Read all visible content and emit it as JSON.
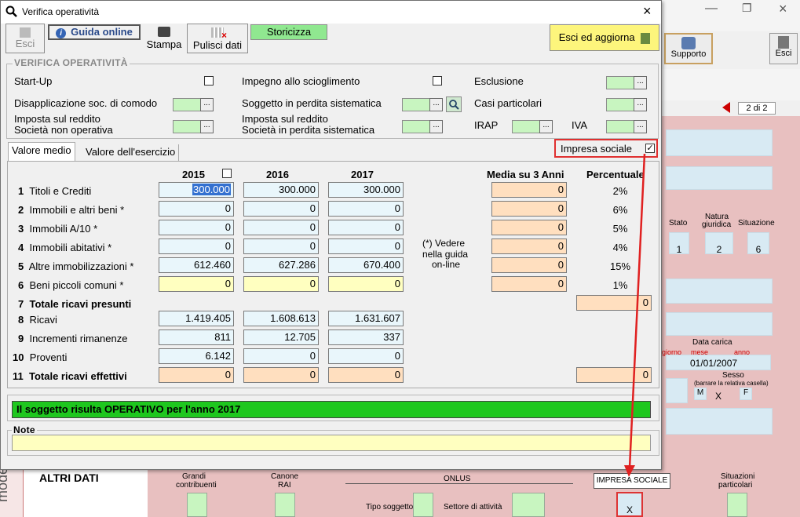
{
  "window": {
    "title": "Verifica operatività",
    "close": "×"
  },
  "toolbar": {
    "esci": "Esci",
    "guida": "Guida online",
    "stampa": "Stampa",
    "pulisci": "Pulisci dati",
    "storicizza": "Storicizza",
    "esci_aggiorna": "Esci ed aggiorna"
  },
  "section_title": "VERIFICA OPERATIVITÀ",
  "fields": {
    "startup": "Start-Up",
    "impegno": "Impegno allo scioglimento",
    "esclusione": "Esclusione",
    "disapplicazione": "Disapplicazione soc. di comodo",
    "soggetto_perdita": "Soggetto in perdita sistematica",
    "casi_particolari": "Casi particolari",
    "imposta1_l1": "Imposta sul reddito",
    "imposta1_l2": "Società non operativa",
    "imposta2_l1": "Imposta sul reddito",
    "imposta2_l2": "Società in perdita sistematica",
    "irap": "IRAP",
    "iva": "IVA",
    "dots": "..."
  },
  "tabs": [
    "Valore medio",
    "Valore dell'esercizio"
  ],
  "impresa_sociale": "Impresa sociale",
  "years": [
    "2015",
    "2016",
    "2017"
  ],
  "media_label": "Media su 3 Anni",
  "percentuale_label": "Percentuale",
  "note_vedere": [
    "(*) Vedere",
    "nella guida",
    "on-line"
  ],
  "rows": [
    {
      "n": "1",
      "label": "Titoli e Crediti",
      "v": [
        "300.000",
        "300.000",
        "300.000"
      ],
      "media": "0",
      "pct": "2%"
    },
    {
      "n": "2",
      "label": "Immobili e altri beni *",
      "v": [
        "0",
        "0",
        "0"
      ],
      "media": "0",
      "pct": "6%"
    },
    {
      "n": "3",
      "label": "Immobili A/10 *",
      "v": [
        "0",
        "0",
        "0"
      ],
      "media": "0",
      "pct": "5%"
    },
    {
      "n": "4",
      "label": "Immobili abitativi *",
      "v": [
        "0",
        "0",
        "0"
      ],
      "media": "0",
      "pct": "4%"
    },
    {
      "n": "5",
      "label": "Altre immobilizzazioni *",
      "v": [
        "612.460",
        "627.286",
        "670.400"
      ],
      "media": "0",
      "pct": "15%"
    },
    {
      "n": "6",
      "label": "Beni piccoli comuni *",
      "v": [
        "0",
        "0",
        "0"
      ],
      "media": "0",
      "pct": "1%"
    },
    {
      "n": "7",
      "label": "Totale ricavi presunti",
      "total": "0"
    },
    {
      "n": "8",
      "label": "Ricavi",
      "v": [
        "1.419.405",
        "1.608.613",
        "1.631.607"
      ]
    },
    {
      "n": "9",
      "label": "Incrementi rimanenze",
      "v": [
        "811",
        "12.705",
        "337"
      ]
    },
    {
      "n": "10",
      "label": "Proventi",
      "v": [
        "6.142",
        "0",
        "0"
      ]
    },
    {
      "n": "11",
      "label": "Totale ricavi effettivi",
      "v": [
        "0",
        "0",
        "0"
      ],
      "total": "0"
    }
  ],
  "status": "Il soggetto risulta OPERATIVO per l'anno 2017",
  "note_label": "Note",
  "background": {
    "supporto": "Supporto",
    "esci": "Esci",
    "page": "2 di 2",
    "stato": "Stato",
    "natura_l1": "Natura",
    "natura_l2": "giuridica",
    "situazione": "Situazione",
    "stato_v": "1",
    "natura_v": "2",
    "situazione_v": "6",
    "data_carica": "Data carica",
    "giorno": "giorno",
    "mese": "mese",
    "anno": "anno",
    "data_v": "01/01/2007",
    "sesso": "Sesso",
    "sesso_sub": "(barrare la relativa casella)",
    "m": "M",
    "x1": "X",
    "f": "F",
    "modello": "modello",
    "altri_dati": "ALTRI DATI",
    "grandi_l1": "Grandi",
    "grandi_l2": "contribuenti",
    "canone_l1": "Canone",
    "canone_l2": "RAI",
    "onlus": "ONLUS",
    "tipo_soggetto": "Tipo soggetto",
    "settore": "Settore di attività",
    "impresa_sociale_btn": "IMPRESA SOCIALE",
    "situazioni_l1": "Situazioni",
    "situazioni_l2": "particolari",
    "x2": "X"
  }
}
